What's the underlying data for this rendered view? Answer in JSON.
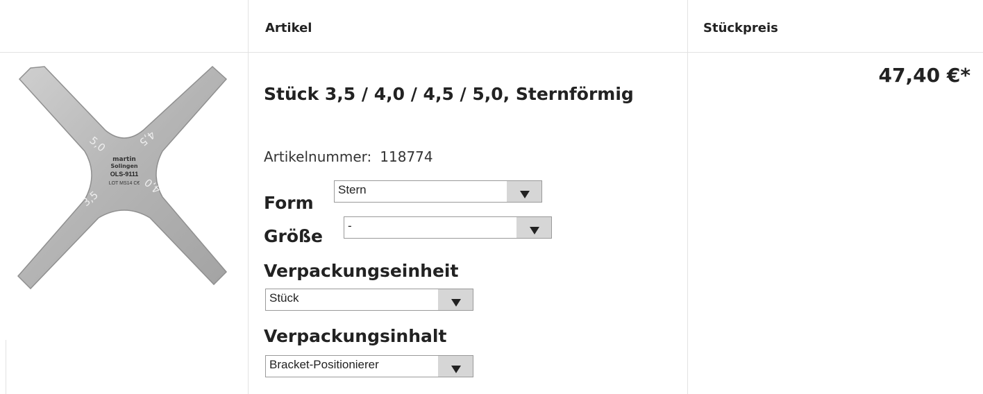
{
  "header": {
    "col_article": "Artikel",
    "col_price": "Stückpreis"
  },
  "product": {
    "title": "Stück 3,5 / 4,0 / 4,5 / 5,0, Sternförmig",
    "article_number_label": "Artikelnummer:",
    "article_number": "118774",
    "price": "47,40 €*",
    "image": {
      "brand_line1": "martin",
      "brand_line2": "Solingen",
      "model": "OLS-9111",
      "lot": "LOT MS14 C€",
      "arm_marks": [
        "5,0",
        "4,5",
        "3,5",
        "4,0"
      ]
    }
  },
  "options": {
    "form": {
      "label": "Form",
      "value": "Stern"
    },
    "size": {
      "label": "Größe",
      "value": "-"
    },
    "packaging_unit": {
      "label": "Verpackungseinheit",
      "value": "Stück"
    },
    "packaging_content": {
      "label": "Verpackungsinhalt",
      "value": "Bracket-Positionierer"
    }
  },
  "icons": {
    "dropdown": "chevron-down-icon"
  },
  "colors": {
    "border": "#e2e2e2",
    "select_button": "#d6d6d6",
    "text": "#222222"
  }
}
